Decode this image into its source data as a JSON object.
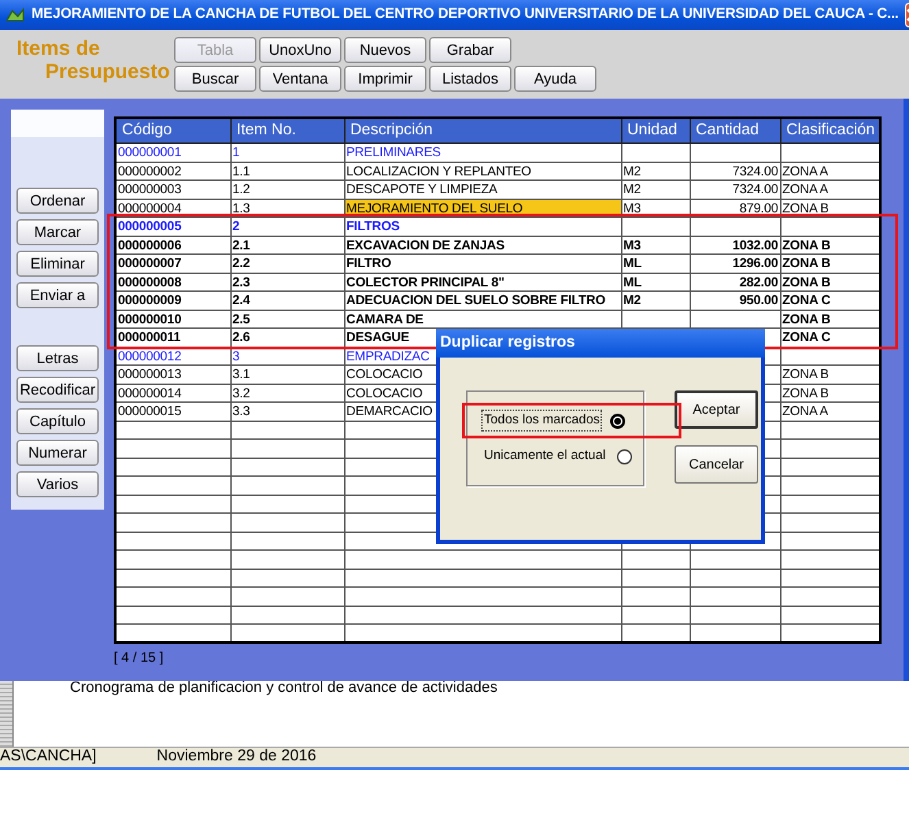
{
  "window": {
    "title": "MEJORAMIENTO DE LA CANCHA DE FUTBOL DEL CENTRO DEPORTIVO UNIVERSITARIO DE LA UNIVERSIDAD DEL CAUCA - C..."
  },
  "header": {
    "title": "Items de Presupuesto"
  },
  "toolbar": {
    "rows": [
      [
        {
          "label": "Tabla",
          "disabled": true
        },
        {
          "label": "UnoxUno",
          "disabled": false
        },
        {
          "label": "Nuevos",
          "disabled": false
        },
        {
          "label": "Grabar",
          "disabled": false
        }
      ],
      [
        {
          "label": "Buscar",
          "disabled": false
        },
        {
          "label": "Ventana",
          "disabled": false
        },
        {
          "label": "Imprimir",
          "disabled": false
        },
        {
          "label": "Listados",
          "disabled": false
        },
        {
          "label": "Ayuda",
          "disabled": false
        }
      ]
    ]
  },
  "side_buttons": {
    "groups": [
      [
        "Ordenar",
        "Marcar",
        "Eliminar",
        "Enviar a"
      ],
      [
        "Letras",
        "Recodificar",
        "Capítulo",
        "Numerar",
        "Varios"
      ]
    ]
  },
  "table": {
    "columns": [
      "Código",
      "Item No.",
      "Descripción",
      "Unidad",
      "Cantidad",
      "Clasificación"
    ],
    "rows": [
      {
        "kind": "chapter",
        "marked": false,
        "selected": false,
        "cells": [
          "000000001",
          "1",
          "PRELIMINARES",
          null,
          null,
          null
        ]
      },
      {
        "kind": "item",
        "marked": false,
        "selected": false,
        "cells": [
          "000000002",
          "1.1",
          "LOCALIZACION Y REPLANTEO",
          "M2",
          "7324.00",
          "ZONA A"
        ]
      },
      {
        "kind": "item",
        "marked": false,
        "selected": false,
        "cells": [
          "000000003",
          "1.2",
          "DESCAPOTE Y LIMPIEZA",
          "M2",
          "7324.00",
          "ZONA A"
        ]
      },
      {
        "kind": "item",
        "marked": false,
        "selected": true,
        "cells": [
          "000000004",
          "1.3",
          "MEJORAMIENTO DEL SUELO",
          "M3",
          "879.00",
          "ZONA B"
        ]
      },
      {
        "kind": "chapter",
        "marked": true,
        "selected": false,
        "cells": [
          "000000005",
          "2",
          "FILTROS",
          null,
          null,
          null
        ]
      },
      {
        "kind": "item",
        "marked": true,
        "selected": false,
        "cells": [
          "000000006",
          "2.1",
          "EXCAVACION DE ZANJAS",
          "M3",
          "1032.00",
          "ZONA B"
        ]
      },
      {
        "kind": "item",
        "marked": true,
        "selected": false,
        "cells": [
          "000000007",
          "2.2",
          "FILTRO",
          "ML",
          "1296.00",
          "ZONA B"
        ]
      },
      {
        "kind": "item",
        "marked": true,
        "selected": false,
        "cells": [
          "000000008",
          "2.3",
          "COLECTOR PRINCIPAL 8\"",
          "ML",
          "282.00",
          "ZONA B"
        ]
      },
      {
        "kind": "item",
        "marked": true,
        "selected": false,
        "cells": [
          "000000009",
          "2.4",
          "ADECUACION DEL SUELO SOBRE FILTRO",
          "M2",
          "950.00",
          "ZONA C"
        ]
      },
      {
        "kind": "item",
        "marked": true,
        "selected": false,
        "cells": [
          "000000010",
          "2.5",
          "CAMARA DE",
          null,
          null,
          "ZONA B"
        ]
      },
      {
        "kind": "item",
        "marked": true,
        "selected": false,
        "cells": [
          "000000011",
          "2.6",
          "DESAGUE",
          null,
          null,
          "ZONA C"
        ]
      },
      {
        "kind": "chapter",
        "marked": false,
        "selected": false,
        "cells": [
          "000000012",
          "3",
          "EMPRADIZAC",
          null,
          null,
          null
        ]
      },
      {
        "kind": "item",
        "marked": false,
        "selected": false,
        "cells": [
          "000000013",
          "3.1",
          "COLOCACIO",
          null,
          null,
          "ZONA B"
        ]
      },
      {
        "kind": "item",
        "marked": false,
        "selected": false,
        "cells": [
          "000000014",
          "3.2",
          "COLOCACIO",
          null,
          null,
          "ZONA B"
        ]
      },
      {
        "kind": "item",
        "marked": false,
        "selected": false,
        "cells": [
          "000000015",
          "3.3",
          "DEMARCACIO",
          null,
          null,
          "ZONA A"
        ]
      }
    ]
  },
  "pager": "[ 4 / 15 ]",
  "description": "Cronograma de planificacion y control de avance de actividades",
  "status_bar": [
    "AS\\CANCHA]",
    "Noviembre 29 de 2016"
  ],
  "dialog": {
    "title": "Duplicar registros",
    "options": [
      {
        "label": "Todos los marcados",
        "selected": true,
        "highlighted": true
      },
      {
        "label": "Unicamente el actual",
        "selected": false,
        "highlighted": false
      }
    ],
    "buttons": [
      {
        "label": "Aceptar",
        "default": true
      },
      {
        "label": "Cancelar",
        "default": false
      }
    ]
  }
}
